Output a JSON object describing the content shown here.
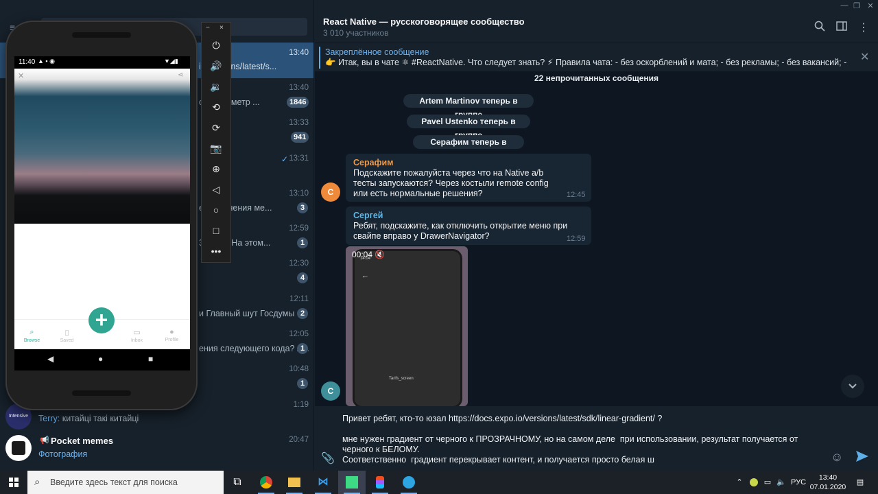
{
  "chat_list": {
    "rows": [
      {
        "time": "13:40",
        "preview": "io/versions/latest/s...",
        "badge": "",
        "active": true
      },
      {
        "time": "13:40",
        "preview": "ой мараметр ...",
        "badge": "1846"
      },
      {
        "time": "13:33",
        "preview": "",
        "badge": "941"
      },
      {
        "time": "13:31",
        "preview": "",
        "badge": "",
        "check": "✓"
      },
      {
        "time": "13:10",
        "preview": "ереключения ме...",
        "badge": "3"
      },
      {
        "time": "12:59",
        "preview": "3 раза?  На этом...",
        "badge": "1"
      },
      {
        "time": "12:30",
        "preview": "",
        "badge": "4"
      },
      {
        "time": "12:11",
        "preview": "и  Главный шут Госдумы ...",
        "badge": "2"
      },
      {
        "time": "12:05",
        "preview": "ения следующего кода?  А...",
        "badge": "1"
      },
      {
        "time": "10:48",
        "preview": "",
        "badge": "1"
      },
      {
        "time": "1:19",
        "preview": "",
        "badge": ""
      }
    ],
    "terry": {
      "sender": "Terry:",
      "text": " китайці такі китайці",
      "avatar_label": "Intensive"
    },
    "pocket": {
      "name": "Pocket memes",
      "time": "20:47",
      "sub": "Фотография"
    }
  },
  "emulator": {
    "status_time": "11:40",
    "tabs": [
      {
        "icon": "search",
        "label": "Browse"
      },
      {
        "icon": "bookmark",
        "label": "Saved"
      },
      {
        "icon": "plus",
        "label": ""
      },
      {
        "icon": "inbox",
        "label": "Inbox"
      },
      {
        "icon": "person",
        "label": "Profile"
      }
    ],
    "fab": "+",
    "toolbar_min": "−",
    "toolbar_close": "×"
  },
  "chat": {
    "title": "React Native — русскоговорящее сообщество",
    "subtitle": "3 010 участников",
    "pinned_title": "Закреплённое сообщение",
    "pinned_text": "👉 Итак, вы в чате ⚛ #ReactNative. Что следует знать?  ⚡ Правила чата: - без оскорблений и мата; - без рекламы; - без вакансий; - без аудио ...",
    "unread": "22 непрочитанных сообщения",
    "service": [
      "Artem Martinov теперь в группе",
      "Pavel Ustenko теперь в группе",
      "Серафим теперь в группе"
    ],
    "messages": [
      {
        "author": "Серафим",
        "text": "Подскажите пожалуйста через что на Native a/b тесты запускаются? Через костыли remote config или есть нормальные решения?",
        "time": "12:45",
        "avatar": "С"
      },
      {
        "author": "Сергей",
        "text": "Ребят, подскажите, как отключить открытие меню при свайпе вправо у DrawerNavigator?",
        "time": "12:59",
        "avatar": "С"
      }
    ],
    "video": {
      "duration": "00:04",
      "inner_time": "14:04",
      "inner_label": "Tarifs_screen"
    },
    "draft": "Привет ребят, кто-то юзал https://docs.expo.io/versions/latest/sdk/linear-gradient/ ?\n\nмне нужен градиент от черного к ПРОЗРАЧНОМУ, но на самом деле  при использовании, результат получается от черного к БЕЛОМУ.\nСоответственно  градиент перекрывает контент, и получается просто белая ш"
  },
  "taskbar": {
    "search_placeholder": "Введите здесь текст для поиска",
    "lang": "РУС",
    "time": "13:40",
    "date": "07.01.2020"
  },
  "colors": {
    "accent": "#2b5278",
    "link": "#6ab3f3",
    "serafim": "#ef9a48",
    "sergey": "#5fb8e8"
  }
}
